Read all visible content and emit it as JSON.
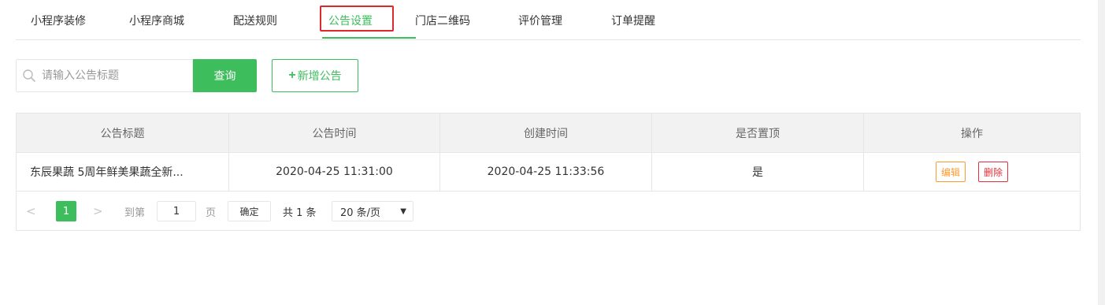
{
  "tabs": [
    {
      "label": "小程序装修"
    },
    {
      "label": "小程序商城"
    },
    {
      "label": "配送规则"
    },
    {
      "label": "公告设置"
    },
    {
      "label": "门店二维码"
    },
    {
      "label": "评价管理"
    },
    {
      "label": "订单提醒"
    }
  ],
  "active_tab": "公告设置",
  "toolbar": {
    "search_placeholder": "请输入公告标题",
    "search_value": "",
    "query_label": "查询",
    "add_plus": "+",
    "add_label": "新增公告"
  },
  "table": {
    "headers": [
      "公告标题",
      "公告时间",
      "创建时间",
      "是否置顶",
      "操作"
    ],
    "rows": [
      {
        "title": "东辰果蔬 5周年鲜美果蔬全新...",
        "notice_time": "2020-04-25 11:31:00",
        "created_time": "2020-04-25 11:33:56",
        "pinned": "是",
        "edit_label": "编辑",
        "delete_label": "删除"
      }
    ]
  },
  "pagination": {
    "prev": "<",
    "current": "1",
    "next": ">",
    "goto_label": "到第",
    "goto_value": "1",
    "page_unit": "页",
    "confirm_label": "确定",
    "total_text": "共 1 条",
    "page_size": "20 条/页",
    "caret": "▼"
  },
  "colors": {
    "accent": "#3dbd5c",
    "edit": "#ff9a2e",
    "delete": "#e8303a",
    "highlight": "#e02828"
  }
}
